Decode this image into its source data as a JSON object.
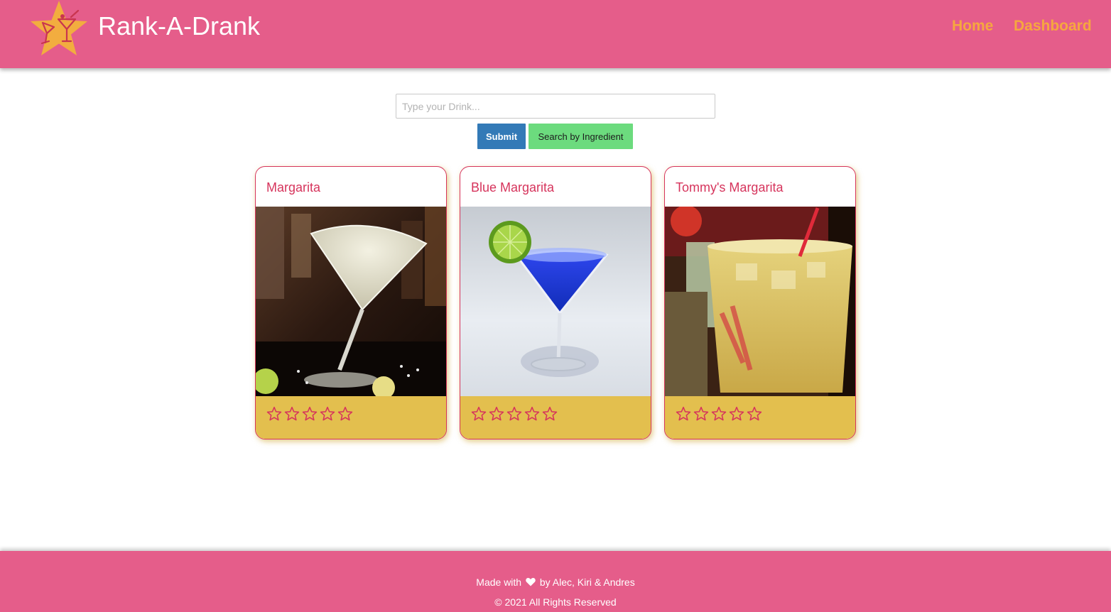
{
  "colors": {
    "header": "#e55d8a",
    "nav_link": "#f6a73f",
    "accent": "#d6345c",
    "card_footer": "#e3bf4e",
    "submit": "#337ab7",
    "ingredient": "#6cdb7e"
  },
  "header": {
    "logo_icon": "star-cocktail-logo-icon",
    "brand": "Rank-A-Drank",
    "nav": {
      "home": "Home",
      "dashboard": "Dashboard"
    }
  },
  "search": {
    "placeholder": "Type your Drink...",
    "value": "",
    "submit_label": "Submit",
    "ingredient_label": "Search by Ingredient"
  },
  "cards": [
    {
      "title": "Margarita",
      "image": "margarita-photo",
      "rating": 0,
      "max_rating": 5
    },
    {
      "title": "Blue Margarita",
      "image": "blue-margarita-photo",
      "rating": 0,
      "max_rating": 5
    },
    {
      "title": "Tommy's Margarita",
      "image": "tommys-margarita-photo",
      "rating": 0,
      "max_rating": 5
    }
  ],
  "footer": {
    "made_with": "Made with",
    "by": "by Alec, Kiri & Andres",
    "heart_icon": "heart-icon",
    "copyright": "© 2021 All Rights Reserved"
  }
}
